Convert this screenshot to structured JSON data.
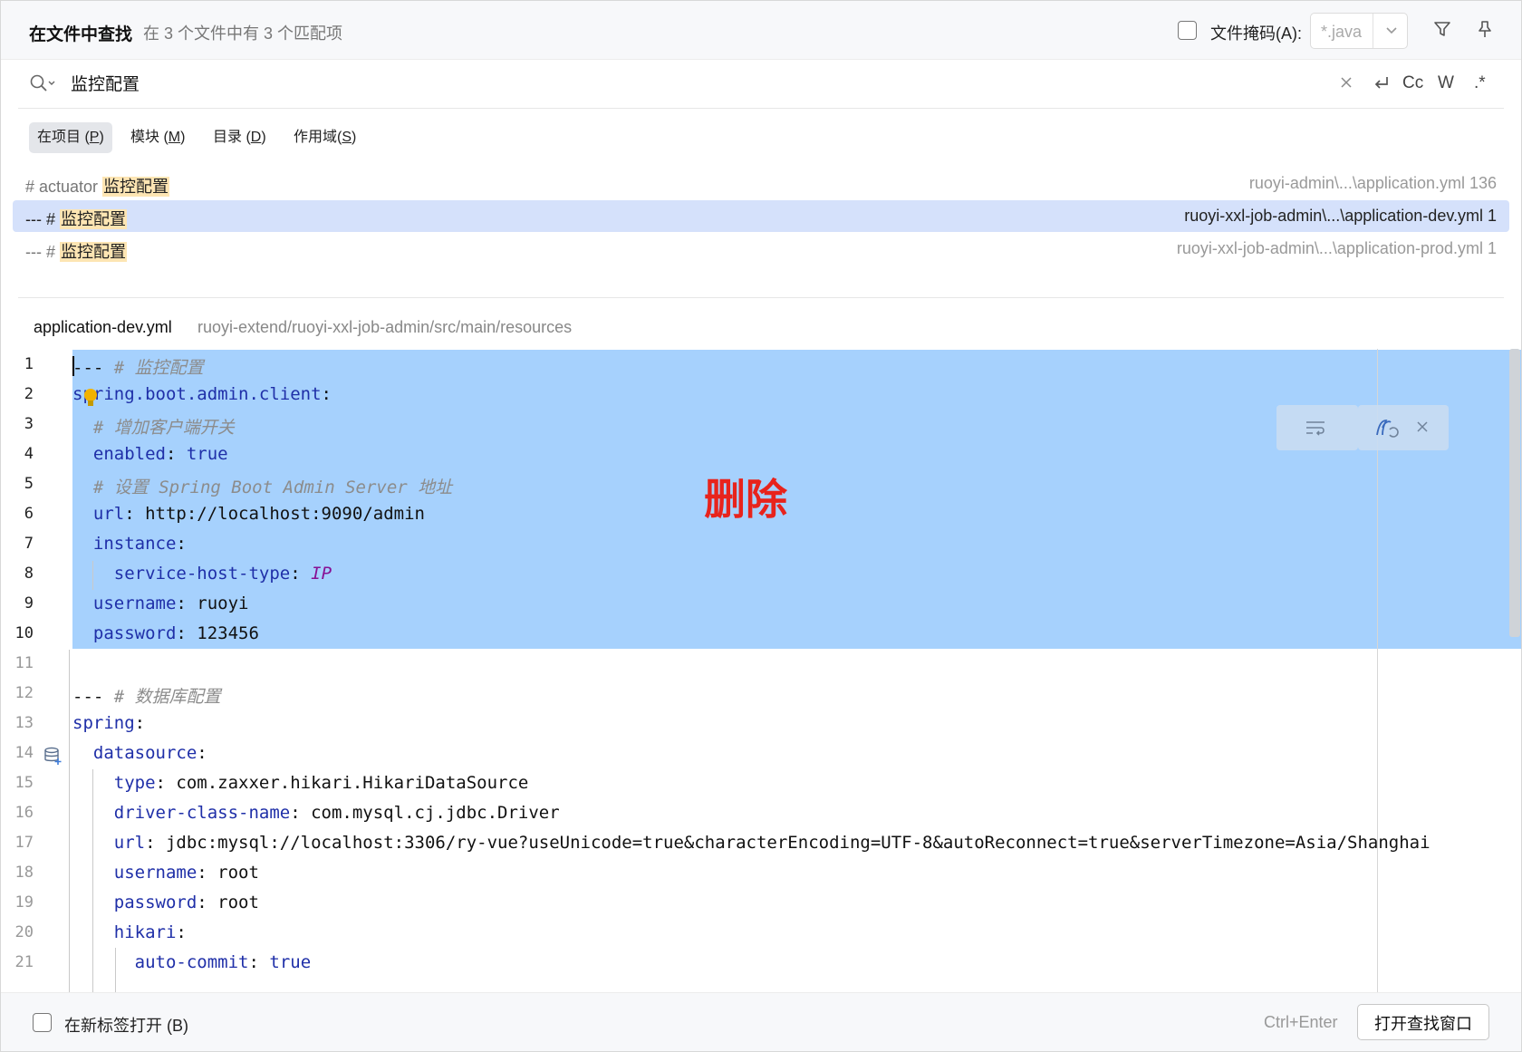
{
  "header": {
    "title": "在文件中查找",
    "match_summary": "在 3 个文件中有 3 个匹配项",
    "file_mask_label": "文件掩码(A):",
    "file_mask_value": "*.java"
  },
  "search": {
    "query": "监控配置",
    "options": {
      "match_case": "Cc",
      "words": "W",
      "regex": ".*"
    }
  },
  "scope_tabs": [
    {
      "label": "在项目 (P)",
      "active": true
    },
    {
      "label": "模块 (M)",
      "active": false
    },
    {
      "label": "目录 (D)",
      "active": false
    },
    {
      "label": "作用域(S)",
      "active": false
    }
  ],
  "results": [
    {
      "prefix": "# actuator ",
      "match": "监控配置",
      "location": "ruoyi-admin\\...\\application.yml 136",
      "selected": false
    },
    {
      "prefix": "--- # ",
      "match": "监控配置",
      "location": "ruoyi-xxl-job-admin\\...\\application-dev.yml 1",
      "selected": true
    },
    {
      "prefix": "--- # ",
      "match": "监控配置",
      "location": "ruoyi-xxl-job-admin\\...\\application-prod.yml 1",
      "selected": false
    }
  ],
  "preview": {
    "file_name": "application-dev.yml",
    "file_path": "ruoyi-extend/ruoyi-xxl-job-admin/src/main/resources"
  },
  "annotation": "删除",
  "footer": {
    "open_in_new_tab_label": "在新标签打开 (B)",
    "shortcut": "Ctrl+Enter",
    "open_window_button": "打开查找窗口"
  },
  "colors": {
    "selection": "#a6d1fd",
    "selected_row": "#d5e1fb",
    "match_highlight": "#fde5b3",
    "annotation": "#e8231c",
    "keyword": "#1f2fa8"
  }
}
